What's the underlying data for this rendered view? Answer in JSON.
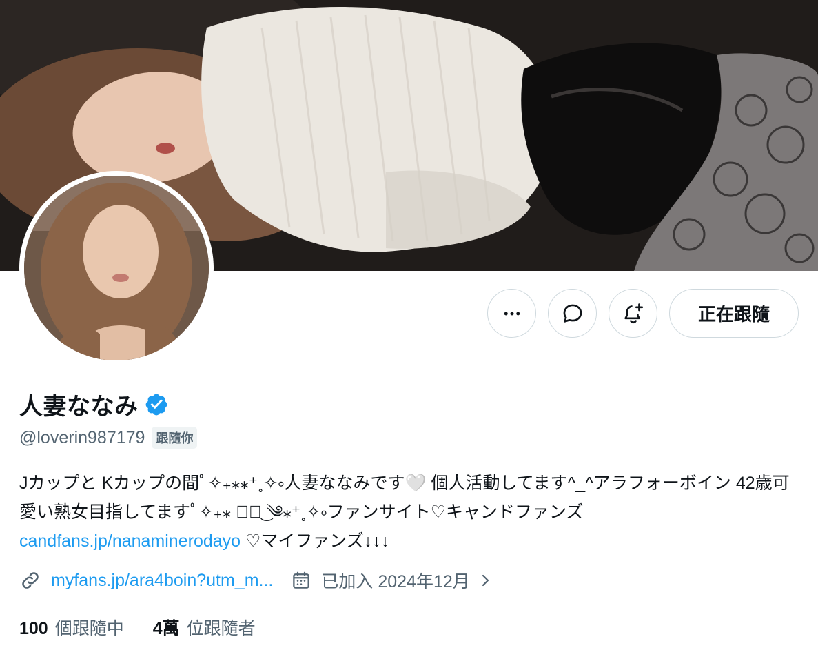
{
  "profile": {
    "display_name": "人妻ななみ",
    "handle": "@loverin987179",
    "follows_you_badge": "跟隨你",
    "verified": true,
    "bio_part1": "Jカップと Kカップの間ﾟ✧₊⁎⁎⁺˳✧༚人妻ななみです🤍 個人活動してます^_^アラフォーボイン 42歳可愛い熟女目指してますﾟ✧₊⁎ ༄ً͜ ༄⁎⁺˳✧༚ファンサイト♡キャンドファンズ",
    "bio_link": "candfans.jp/nanaminerodayo",
    "bio_part2": " ♡マイファンズ↓↓↓"
  },
  "meta": {
    "website": "myfans.jp/ara4boin?utm_m...",
    "joined": "已加入 2024年12月"
  },
  "stats": {
    "following_count": "100",
    "following_label": "個跟隨中",
    "followers_count": "4萬",
    "followers_label": "位跟隨者"
  },
  "actions": {
    "more_icon": "more-horizontal-icon",
    "message_icon": "message-bubble-icon",
    "notify_icon": "bell-plus-icon",
    "follow_label": "正在跟隨"
  },
  "colors": {
    "accent": "#1d9bf0",
    "verified": "#1d9bf0",
    "text_primary": "#0f1419",
    "text_secondary": "#536471",
    "border": "#cfd9de"
  }
}
